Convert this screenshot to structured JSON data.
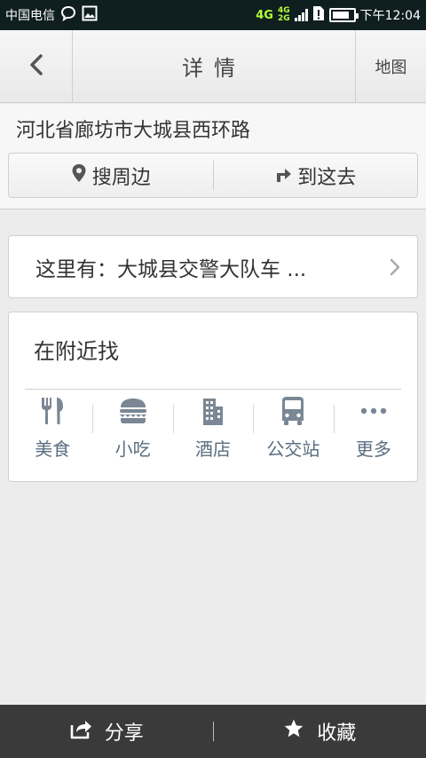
{
  "status_bar": {
    "carrier": "中国电信",
    "network_4g": "4G",
    "network_stack_top": "4G",
    "network_stack_bottom": "2G",
    "time": "下午12:04",
    "battery_level": 0.8
  },
  "header": {
    "title": "详情",
    "map_label": "地图"
  },
  "address": {
    "text": "河北省廊坊市大城县西环路",
    "actions": [
      {
        "icon": "location-pin-icon",
        "label": "搜周边"
      },
      {
        "icon": "turn-arrow-icon",
        "label": "到这去"
      }
    ]
  },
  "here": {
    "text": "这里有：大城县交警大队车 ..."
  },
  "nearby": {
    "title": "在附近找",
    "categories": [
      {
        "icon": "fork-knife-icon",
        "label": "美食"
      },
      {
        "icon": "burger-icon",
        "label": "小吃"
      },
      {
        "icon": "hotel-building-icon",
        "label": "酒店"
      },
      {
        "icon": "bus-icon",
        "label": "公交站"
      },
      {
        "icon": "more-dots-icon",
        "label": "更多"
      }
    ]
  },
  "bottom_bar": {
    "share_label": "分享",
    "favorite_label": "收藏"
  },
  "colors": {
    "status_bar_bg": "#0f1f1f",
    "network_green": "#b6ff3a",
    "category_label": "#5a6d80",
    "icon_gray": "#7a8794",
    "bottom_bar_bg": "#3a3a3a"
  }
}
